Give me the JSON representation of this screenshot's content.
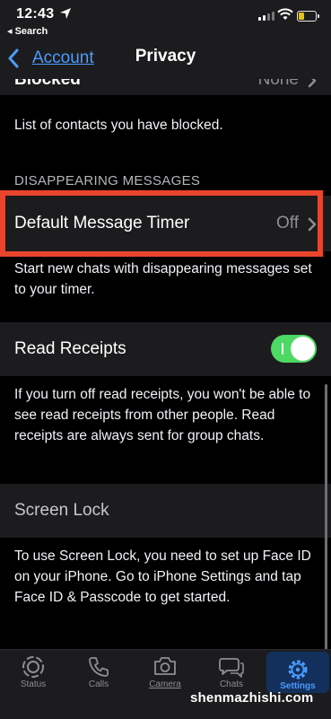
{
  "status_bar": {
    "time": "12:43",
    "back_app": "◂ Search"
  },
  "nav": {
    "back_label": "Account",
    "title": "Privacy"
  },
  "rows": {
    "blocked": {
      "label": "Blocked",
      "value": "None"
    },
    "blocked_footer": "List of contacts you have blocked.",
    "disappearing_header": "DISAPPEARING MESSAGES",
    "timer": {
      "label": "Default Message Timer",
      "value": "Off"
    },
    "timer_footer": "Start new chats with disappearing messages set to your timer.",
    "read_receipts": {
      "label": "Read Receipts",
      "on": true
    },
    "read_receipts_footer": "If you turn off read receipts, you won't be able to see read receipts from other people. Read receipts are always sent for group chats.",
    "screen_lock": {
      "label": "Screen Lock"
    },
    "screen_lock_footer": "To use Screen Lock, you need to set up Face ID on your iPhone. Go to iPhone Settings and tap Face ID & Passcode to get started."
  },
  "tabs": [
    {
      "label": "Status",
      "icon": "status-icon"
    },
    {
      "label": "Calls",
      "icon": "phone-icon"
    },
    {
      "label": "Camera",
      "icon": "camera-icon"
    },
    {
      "label": "Chats",
      "icon": "chats-icon"
    },
    {
      "label": "Settings",
      "icon": "gear-icon",
      "active": true
    }
  ],
  "watermark": "shenmazhishi.com",
  "colors": {
    "accent": "#4a9cff",
    "toggle_on": "#4cd964",
    "highlight": "#e8452c"
  }
}
